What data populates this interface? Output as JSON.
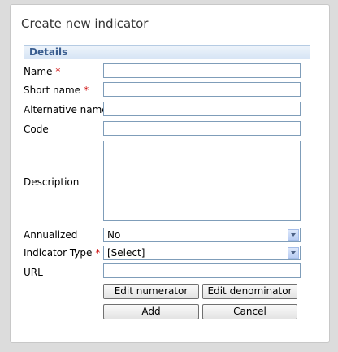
{
  "dialog": {
    "title": "Create new indicator",
    "section": "Details"
  },
  "fields": {
    "name": {
      "label": "Name",
      "required": "*",
      "value": ""
    },
    "short_name": {
      "label": "Short name",
      "required": "*",
      "value": ""
    },
    "alternative_name": {
      "label": "Alternative name",
      "value": ""
    },
    "code": {
      "label": "Code",
      "value": ""
    },
    "description": {
      "label": "Description",
      "value": ""
    },
    "annualized": {
      "label": "Annualized",
      "selected": "No"
    },
    "indicator_type": {
      "label": "Indicator Type",
      "required": "*",
      "selected": "[Select]"
    },
    "url": {
      "label": "URL",
      "value": ""
    }
  },
  "buttons": {
    "edit_numerator": "Edit numerator",
    "edit_denominator": "Edit denominator",
    "add": "Add",
    "cancel": "Cancel"
  }
}
